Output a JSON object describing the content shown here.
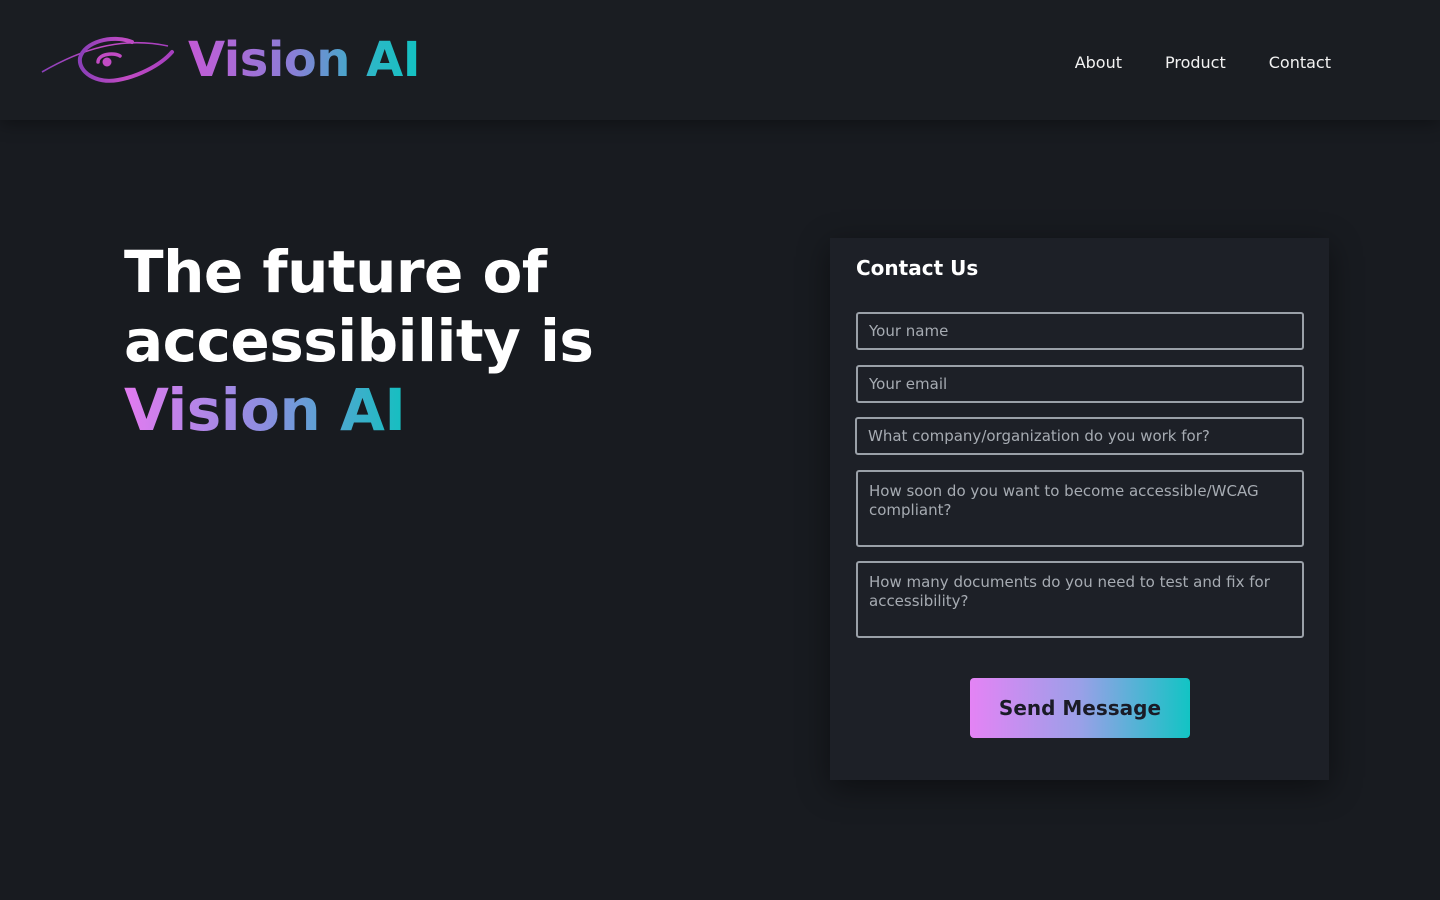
{
  "brand": {
    "name": "Vision AI",
    "logo_icon": "eye-swoosh-icon",
    "gradient_start": "#c45ad6",
    "gradient_end": "#12c2c2"
  },
  "nav": {
    "items": [
      {
        "label": "About"
      },
      {
        "label": "Product"
      },
      {
        "label": "Contact"
      }
    ]
  },
  "hero": {
    "line1": "The future of",
    "line2": "accessibility is",
    "highlight": "Vision AI"
  },
  "contact_form": {
    "title": "Contact Us",
    "name_placeholder": "Your name",
    "email_placeholder": "Your email",
    "company_placeholder": "What company/organization do you work for?",
    "timeline_placeholder": "How soon do you want to become accessible/WCAG compliant?",
    "documents_placeholder": "How many documents do you need to test and fix for accessibility?",
    "submit_label": "Send Message"
  },
  "colors": {
    "background": "#181b20",
    "card": "#1d2027",
    "field_border": "#9aa0a8",
    "button_gradient_start": "#e483f5",
    "button_gradient_end": "#12c4c4"
  }
}
